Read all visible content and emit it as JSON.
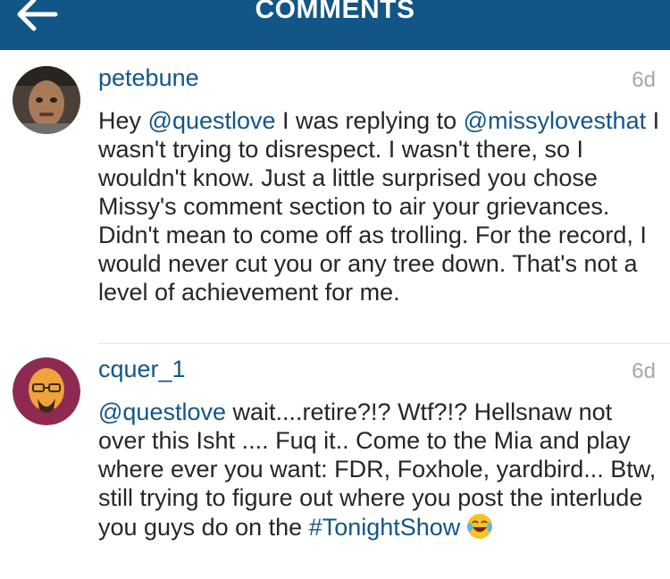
{
  "header": {
    "title": "COMMENTS",
    "back_icon": "back-arrow-icon",
    "background_color": "#125688"
  },
  "comments": [
    {
      "username": "petebune",
      "timestamp": "6d",
      "segments": [
        {
          "text": "Hey ",
          "kind": "text"
        },
        {
          "text": "@questlove",
          "kind": "mention"
        },
        {
          "text": " I was replying to ",
          "kind": "text"
        },
        {
          "text": "@missylovesthat",
          "kind": "mention"
        },
        {
          "text": " I wasn't trying to disrespect. I wasn't there, so I wouldn't know. Just a little surprised you chose Missy's comment section to air your grievances.  Didn't mean to come off as trolling. For the record, I would never cut you or any tree down. That's not a level of achievement for me.",
          "kind": "text"
        }
      ]
    },
    {
      "username": "cquer_1",
      "timestamp": "6d",
      "segments": [
        {
          "text": "@questlove",
          "kind": "mention"
        },
        {
          "text": " wait....retire?!? Wtf?!? Hellsnaw not over this Isht .... Fuq it.. Come to the Mia and play where ever you want: FDR, Foxhole, yardbird... Btw, still trying to figure out where you post the interlude you guys do on the ",
          "kind": "text"
        },
        {
          "text": "#TonightShow",
          "kind": "hashtag"
        }
      ],
      "trailing_icon": "tears-of-joy-emoji-icon"
    }
  ],
  "colors": {
    "link": "#125688",
    "text": "#262626",
    "timestamp": "#a5a7aa"
  }
}
